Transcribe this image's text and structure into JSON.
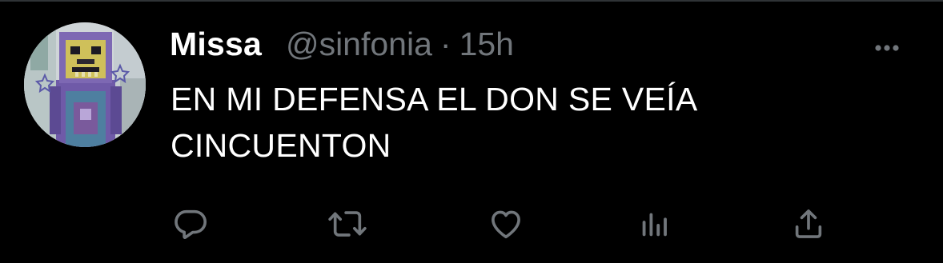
{
  "tweet": {
    "display_name": "Missa",
    "handle": "@sinfonia",
    "separator": "·",
    "timestamp": "15h",
    "text": "EN MI DEFENSA EL DON SE VEÍA\nCINCUENTON"
  },
  "icons": {
    "more": "more-horizontal-icon",
    "reply": "reply-icon",
    "retweet": "retweet-icon",
    "like": "heart-icon",
    "analytics": "analytics-icon",
    "share": "share-icon"
  },
  "colors": {
    "background": "#000000",
    "text_primary": "#ffffff",
    "text_secondary": "#71767b",
    "icon": "#71767b"
  }
}
